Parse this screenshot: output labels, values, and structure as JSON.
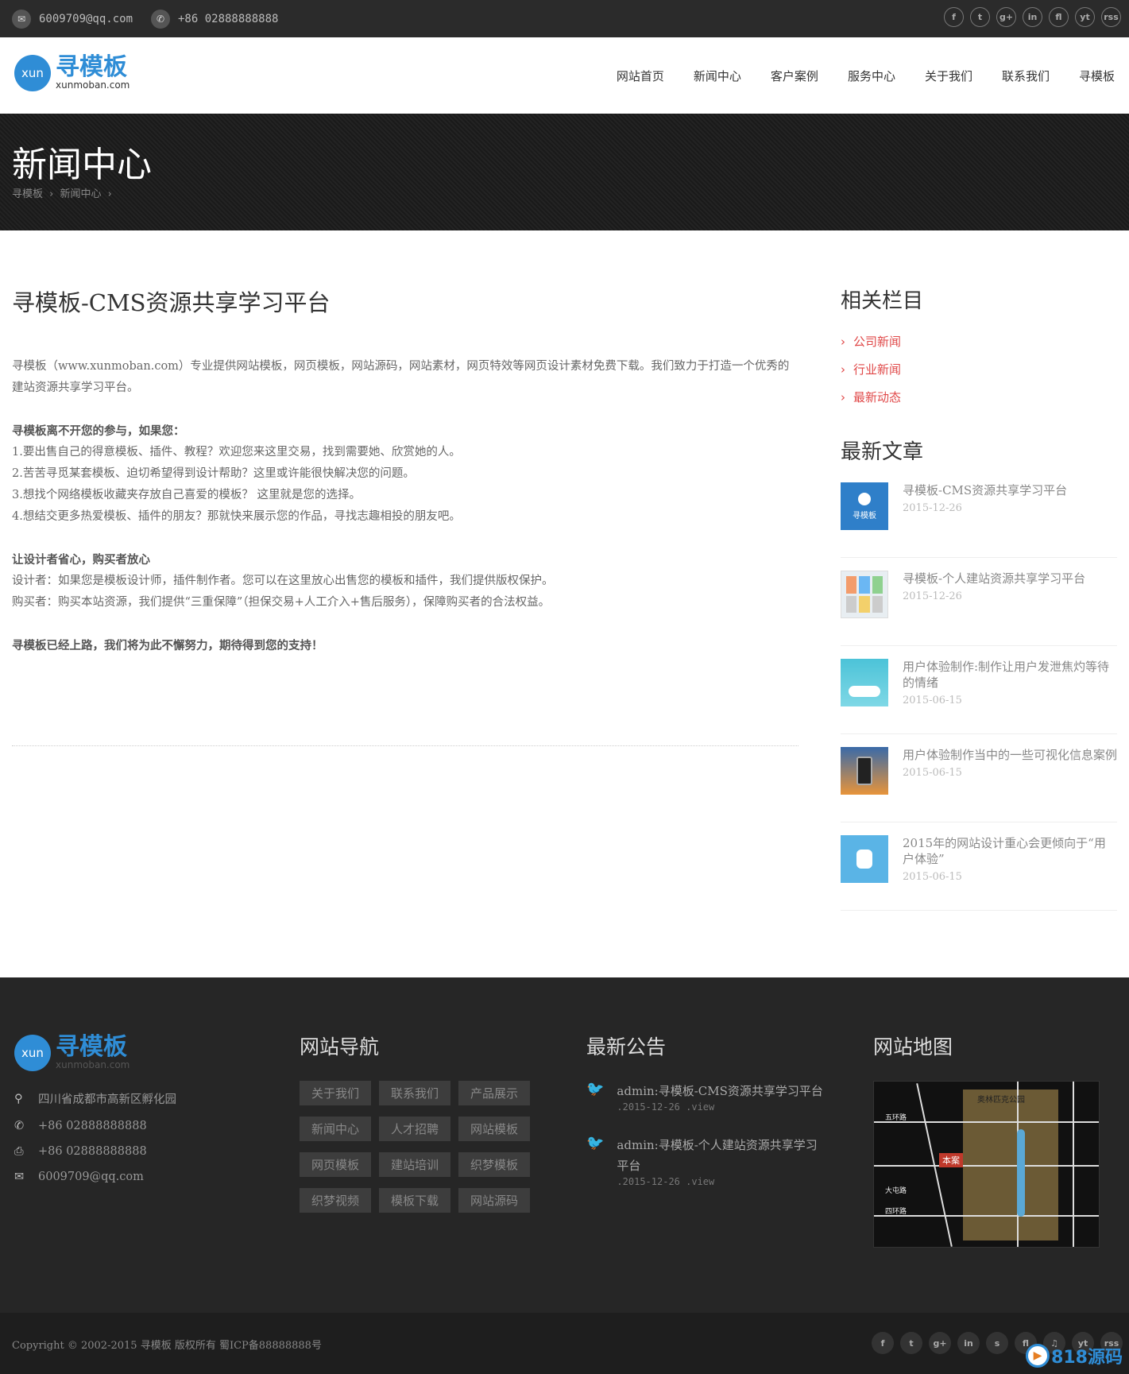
{
  "topbar": {
    "email": "6009709@qq.com",
    "phone": "+86 02888888888",
    "social": [
      "f",
      "t",
      "g+",
      "in",
      "fl",
      "yt",
      "rss"
    ]
  },
  "logo": {
    "circle_text": "xun",
    "cn": "寻模板",
    "en": "xunmoban.com"
  },
  "nav": [
    "网站首页",
    "新闻中心",
    "客户案例",
    "服务中心",
    "关于我们",
    "联系我们",
    "寻模板"
  ],
  "banner": {
    "title": "新闻中心",
    "crumbs": [
      "寻模板",
      "›",
      "新闻中心",
      "›"
    ]
  },
  "article": {
    "title": "寻模板-CMS资源共享学习平台",
    "p1": "寻模板（www.xunmoban.com）专业提供网站模板，网页模板，网站源码，网站素材，网页特效等网页设计素材免费下载。我们致力于打造一个优秀的建站资源共享学习平台。",
    "h2": "寻模板离不开您的参与，如果您：",
    "l1": "1.要出售自己的得意模板、插件、教程？欢迎您来这里交易，找到需要她、欣赏她的人。",
    "l2": "2.苦苦寻觅某套模板、迫切希望得到设计帮助？这里或许能很快解决您的问题。",
    "l3": "3.想找个网络模板收藏夹存放自己喜爱的模板？ 这里就是您的选择。",
    "l4": "4.想结交更多热爱模板、插件的朋友？那就快来展示您的作品，寻找志趣相投的朋友吧。",
    "h3": "让设计者省心，购买者放心",
    "d1": "设计者：如果您是模板设计师，插件制作者。您可以在这里放心出售您的模板和插件，我们提供版权保护。",
    "d2": "购买者：购买本站资源，我们提供“三重保障”（担保交易+人工介入+售后服务），保障购买者的合法权益。",
    "end": "寻模板已经上路，我们将为此不懈努力，期待得到您的支持！"
  },
  "sidebar": {
    "cat_title": "相关栏目",
    "cats": [
      "公司新闻",
      "行业新闻",
      "最新动态"
    ],
    "posts_title": "最新文章",
    "posts": [
      {
        "title": "寻模板-CMS资源共享学习平台",
        "date": "2015-12-26",
        "thumb_label": "寻模板",
        "color": "#2f7fc9"
      },
      {
        "title": "寻模板-个人建站资源共享学习平台",
        "date": "2015-12-26",
        "thumb_label": "",
        "color": "#e8eef2"
      },
      {
        "title": "用户体验制作:制作让用户发泄焦灼等待的情绪",
        "date": "2015-06-15",
        "thumb_label": "",
        "color": "#4cc3d8"
      },
      {
        "title": "用户体验制作当中的一些可视化信息案例",
        "date": "2015-06-15",
        "thumb_label": "",
        "color": "#3a6aa8"
      },
      {
        "title": "2015年的网站设计重心会更倾向于“用户体验”",
        "date": "2015-06-15",
        "thumb_label": "",
        "color": "#5ab4e6"
      }
    ]
  },
  "footer": {
    "contact": {
      "address": "四川省成都市高新区孵化园",
      "phone": "+86 02888888888",
      "fax": "+86 02888888888",
      "email": "6009709@qq.com"
    },
    "nav_title": "网站导航",
    "tags": [
      "关于我们",
      "联系我们",
      "产品展示",
      "新闻中心",
      "人才招聘",
      "网站模板",
      "网页模板",
      "建站培训",
      "织梦模板",
      "织梦视频",
      "模板下载",
      "网站源码"
    ],
    "notice_title": "最新公告",
    "notices": [
      {
        "title": "admin:寻模板-CMS资源共享学习平台",
        "date": ".2015-12-26 .view"
      },
      {
        "title": "admin:寻模板-个人建站资源共享学习平台",
        "date": ".2015-12-26 .view"
      }
    ],
    "map_title": "网站地图",
    "map_labels": {
      "top": "奥林匹克公园",
      "marker": "本案",
      "r1": "五环路",
      "r2": "四环路",
      "r3": "大屯路"
    }
  },
  "bottom": {
    "copyright": "Copyright © 2002-2015 寻模板 版权所有   蜀ICP备88888888号",
    "social": [
      "f",
      "t",
      "g+",
      "in",
      "s",
      "fl",
      "♫",
      "yt",
      "rss"
    ],
    "watermark": "818源码"
  }
}
